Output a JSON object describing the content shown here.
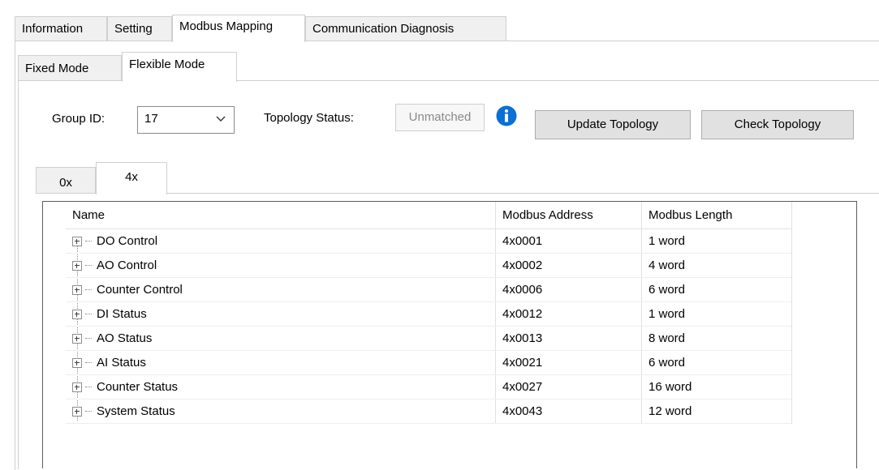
{
  "top_tabs": [
    {
      "label": "Information",
      "active": false
    },
    {
      "label": "Setting",
      "active": false
    },
    {
      "label": "Modbus Mapping",
      "active": true
    },
    {
      "label": "Communication Diagnosis",
      "active": false
    }
  ],
  "mode_tabs": [
    {
      "label": "Fixed Mode",
      "active": false
    },
    {
      "label": "Flexible Mode",
      "active": true
    }
  ],
  "toolbar": {
    "group_id_label": "Group ID:",
    "group_id_value": "17",
    "topology_status_label": "Topology Status:",
    "topology_status_value": "Unmatched",
    "info_icon": "info-icon",
    "update_topology_label": "Update Topology",
    "check_topology_label": "Check Topology"
  },
  "register_tabs": [
    {
      "label": "0x",
      "active": false
    },
    {
      "label": "4x",
      "active": true
    }
  ],
  "table": {
    "columns": [
      "Name",
      "Modbus Address",
      "Modbus Length"
    ],
    "rows": [
      {
        "name": "DO Control",
        "address": "4x0001",
        "length": "1 word"
      },
      {
        "name": "AO Control",
        "address": "4x0002",
        "length": "4 word"
      },
      {
        "name": "Counter Control",
        "address": "4x0006",
        "length": "6 word"
      },
      {
        "name": "DI Status",
        "address": "4x0012",
        "length": "1 word"
      },
      {
        "name": "AO Status",
        "address": "4x0013",
        "length": "8 word"
      },
      {
        "name": "AI Status",
        "address": "4x0021",
        "length": "6 word"
      },
      {
        "name": "Counter Status",
        "address": "4x0027",
        "length": "16 word"
      },
      {
        "name": "System Status",
        "address": "4x0043",
        "length": "12 word"
      }
    ]
  },
  "colors": {
    "info_blue": "#0a6fd6",
    "button_face": "#e1e1e1",
    "tab_inactive": "#f0f0f0"
  }
}
